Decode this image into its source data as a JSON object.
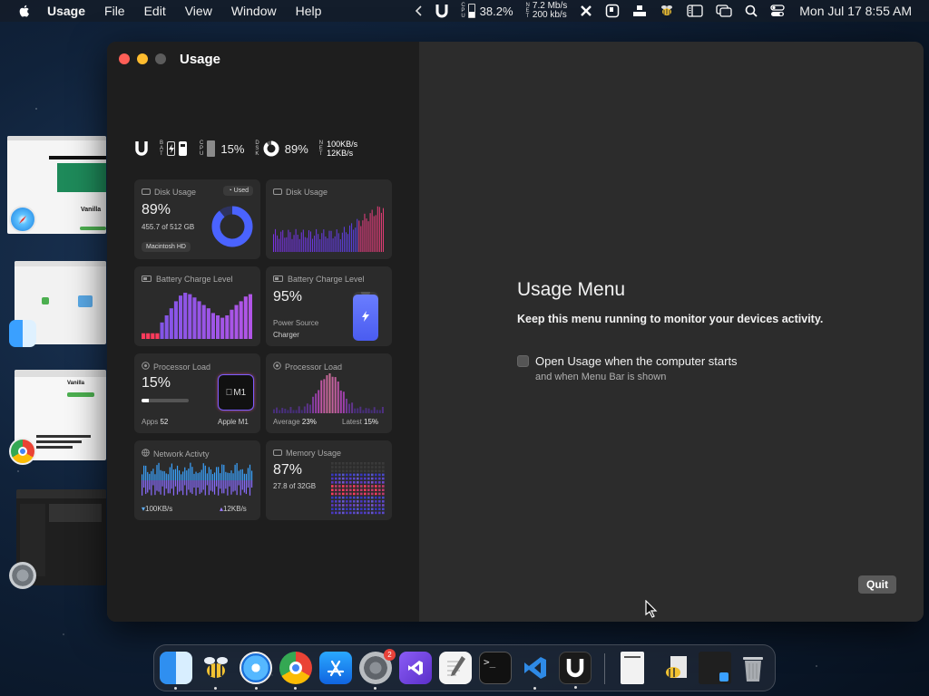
{
  "menubar": {
    "app_name": "Usage",
    "menus": [
      "File",
      "Edit",
      "View",
      "Window",
      "Help"
    ],
    "cpu_label": "CPU",
    "cpu_value": "38.2%",
    "net_label": "NET",
    "net_down": "7.2 Mb/s",
    "net_up": "200 kb/s",
    "clock": "Mon Jul 17  8:55 AM",
    "icons": [
      "apple-icon",
      "chevron-left-icon",
      "usage-u-icon",
      "close-x-icon",
      "screenshot-icon",
      "grid-icon",
      "bee-icon",
      "sidebar-icon",
      "windows-icon",
      "search-icon",
      "control-center-icon"
    ]
  },
  "window": {
    "title": "Usage",
    "indicators": {
      "bat_label": "BAT",
      "cpu_label": "CPU",
      "cpu_value": "15%",
      "dsk_label": "DSK",
      "dsk_value": "89%",
      "net_label": "NET",
      "net_down": "100KB/s",
      "net_up": "12KB/s"
    },
    "widgets": {
      "disk1": {
        "title": "Disk Usage",
        "pill": "Used",
        "percent": "89%",
        "detail": "455.7 of 512 GB",
        "chip": "Macintosh HD",
        "used_fraction": 0.89
      },
      "disk2": {
        "title": "Disk Usage"
      },
      "battery1": {
        "title": "Battery Charge Level"
      },
      "battery2": {
        "title": "Battery Charge Level",
        "percent": "95%",
        "source_label": "Power Source",
        "source_value": "Charger",
        "level": 0.95
      },
      "cpu1": {
        "title": "Processor Load",
        "percent": "15%",
        "apps_label": "Apps",
        "apps_value": "52",
        "chip_name": "M1",
        "chip_full": "Apple M1",
        "load": 0.15
      },
      "cpu2": {
        "title": "Processor Load",
        "avg_label": "Average",
        "avg_value": "23%",
        "latest_label": "Latest",
        "latest_value": "15%"
      },
      "network": {
        "title": "Network Activty",
        "down": "100KB/s",
        "up": "12KB/s"
      },
      "memory": {
        "title": "Memory Usage",
        "percent": "87%",
        "detail": "27.8 of 32GB"
      }
    },
    "pane": {
      "title": "Usage Menu",
      "subtitle": "Keep this menu running to monitor your devices activity.",
      "checkbox_label": "Open Usage when the computer starts",
      "checkbox_sub": "and when Menu Bar is shown",
      "quit_label": "Quit"
    }
  },
  "thumbnails": [
    {
      "app": "safari-icon",
      "caption": "Vanilla"
    },
    {
      "app": "finder-icon"
    },
    {
      "app": "chrome-icon",
      "caption": "Vanilla"
    },
    {
      "app": "settings-icon"
    }
  ],
  "dock": {
    "apps": [
      "finder-icon",
      "bee-icon",
      "safari-icon",
      "chrome-icon",
      "app-store-icon",
      "system-settings-icon",
      "visual-studio-icon",
      "textedit-icon",
      "terminal-icon",
      "vscode-icon",
      "usage-icon",
      "document-icon",
      "bee-doc-icon",
      "finder-window-icon",
      "trash-icon"
    ],
    "badge": "2"
  },
  "colors": {
    "accent_blue": "#4a63ff",
    "chart_purple": "#7a55ff",
    "chart_red": "#ff3b5c",
    "close": "#ff5f57",
    "minimize": "#febc2e",
    "zoom": "#6b6b6b"
  }
}
